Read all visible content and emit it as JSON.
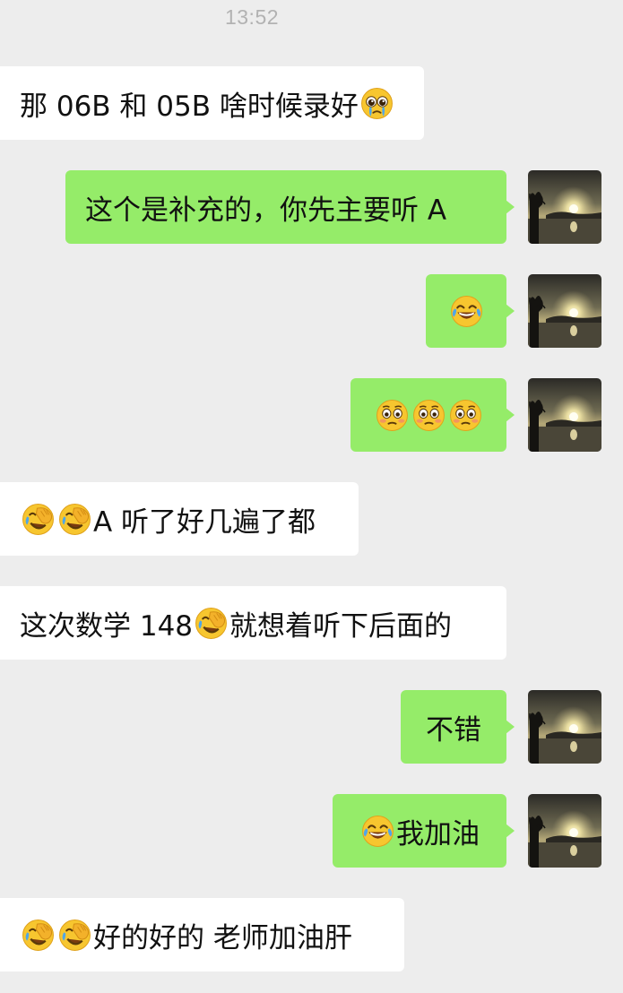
{
  "status": {
    "time": "13:52"
  },
  "messages": [
    {
      "side": "recv",
      "parts": [
        {
          "t": "text",
          "v": "那 06B 和 05B 啥时候录好"
        },
        {
          "t": "emoji",
          "v": "pleading-emoji"
        }
      ]
    },
    {
      "side": "sent",
      "parts": [
        {
          "t": "text",
          "v": "这个是补充的，你先主要听 A"
        }
      ]
    },
    {
      "side": "sent",
      "parts": [
        {
          "t": "emoji",
          "v": "laughing-emoji"
        }
      ]
    },
    {
      "side": "sent",
      "parts": [
        {
          "t": "emoji",
          "v": "flushed-emoji"
        },
        {
          "t": "emoji",
          "v": "flushed-emoji"
        },
        {
          "t": "emoji",
          "v": "flushed-emoji"
        }
      ]
    },
    {
      "side": "recv",
      "parts": [
        {
          "t": "emoji",
          "v": "facepalm-emoji"
        },
        {
          "t": "emoji",
          "v": "facepalm-emoji"
        },
        {
          "t": "text",
          "v": "A 听了好几遍了都"
        }
      ]
    },
    {
      "side": "recv",
      "parts": [
        {
          "t": "text",
          "v": "这次数学 148"
        },
        {
          "t": "emoji",
          "v": "facepalm-emoji"
        },
        {
          "t": "text",
          "v": "就想着听下后面的"
        }
      ]
    },
    {
      "side": "sent",
      "parts": [
        {
          "t": "text",
          "v": "不错"
        }
      ]
    },
    {
      "side": "sent",
      "parts": [
        {
          "t": "emoji",
          "v": "laughing-emoji"
        },
        {
          "t": "text",
          "v": "我加油"
        }
      ]
    },
    {
      "side": "recv",
      "parts": [
        {
          "t": "emoji",
          "v": "facepalm-emoji"
        },
        {
          "t": "emoji",
          "v": "facepalm-emoji"
        },
        {
          "t": "text",
          "v": "好的好的 老师加油肝"
        }
      ]
    }
  ],
  "colors": {
    "background": "#ededed",
    "sent_bubble": "#95ec69",
    "recv_bubble": "#ffffff",
    "timestamp": "#b2b2b2"
  },
  "avatar": {
    "icon": "sunset-avatar"
  }
}
